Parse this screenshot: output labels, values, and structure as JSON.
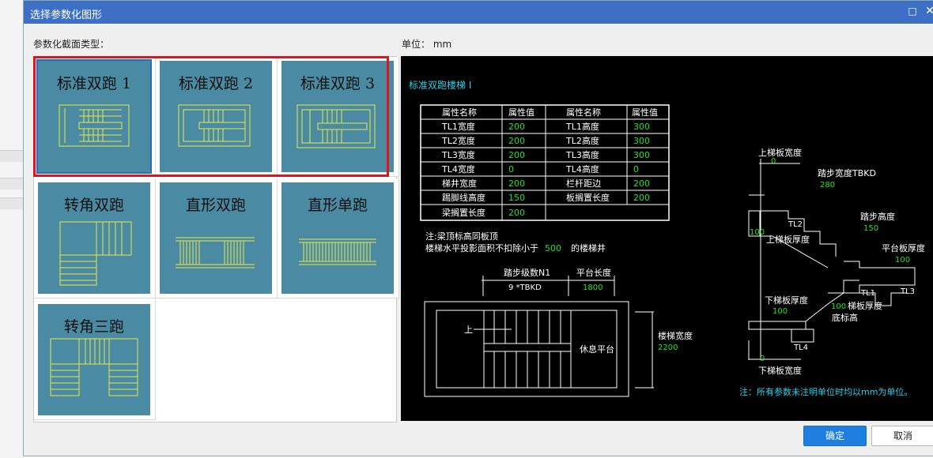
{
  "window": {
    "title": "选择参数化图形"
  },
  "left_label": "参数化截面类型：",
  "unit_label": "单位：  mm",
  "shapes": [
    {
      "name": "标准双跑 1",
      "selected": true
    },
    {
      "name": "标准双跑 2"
    },
    {
      "name": "标准双跑 3"
    },
    {
      "name": "转角双跑"
    },
    {
      "name": "直形双跑"
    },
    {
      "name": "直形单跑"
    },
    {
      "name": "转角三跑"
    }
  ],
  "preview": {
    "heading": "标准双跑楼梯 I",
    "table": {
      "headers": [
        "属性名称",
        "属性值",
        "属性名称",
        "属性值"
      ],
      "rows": [
        [
          "TL1宽度",
          "200",
          "TL1高度",
          "300"
        ],
        [
          "TL2宽度",
          "200",
          "TL2高度",
          "300"
        ],
        [
          "TL3宽度",
          "200",
          "TL3高度",
          "300"
        ],
        [
          "TL4宽度",
          "0",
          "TL4高度",
          "0"
        ],
        [
          "梯井宽度",
          "200",
          "栏杆距边",
          "200"
        ],
        [
          "踢脚线高度",
          "150",
          "板搁置长度",
          "200"
        ],
        [
          "梁搁置长度",
          "200",
          "",
          ""
        ]
      ]
    },
    "note1": "注:梁顶标高同板顶",
    "note2_a": "楼梯水平投影面积不扣除小于",
    "note2_val": "500",
    "note2_b": "的楼梯井",
    "plan": {
      "steps_label": "踏步级数N1",
      "steps_value": "9  *TBKD",
      "landing_len_label": "平台长度",
      "landing_len_value": "1800",
      "up_label": "上",
      "landing_label": "休息平台",
      "width_label": "楼梯宽度",
      "width_value": "2200"
    },
    "section": {
      "upper_slab_width_label": "上梯板宽度",
      "upper_slab_width_value": "0",
      "tread_width_label": "踏步宽度TBKD",
      "tread_width_value": "280",
      "tl2": "TL2",
      "riser_label": "踏步高度",
      "riser_value": "150",
      "left_value": "100",
      "upper_thk_label": "上梯板厚度",
      "landing_thk_label": "平台板厚度",
      "landing_thk_value": "100",
      "tl1": "TL1",
      "tl3": "TL3",
      "lower_thk_label": "下梯板厚度",
      "lower_thk_value": "100",
      "slab_thk_value": "100",
      "slab_thk_label": "梯板厚度",
      "bottom_elev_label": "底标高",
      "tl4": "TL4",
      "lower_slab_width_value": "0",
      "lower_slab_width_label": "下梯板宽度"
    },
    "footnote": "注：所有参数未注明单位时均以mm为单位。"
  },
  "buttons": {
    "ok": "确定",
    "cancel": "取消"
  },
  "colors": {
    "tile": "#4a8aa3",
    "lines": "#e8e84a",
    "accent": "#1f7fe0",
    "highlight": "#e0141e",
    "value_green": "#27e027",
    "cyan": "#2fd0e8"
  }
}
